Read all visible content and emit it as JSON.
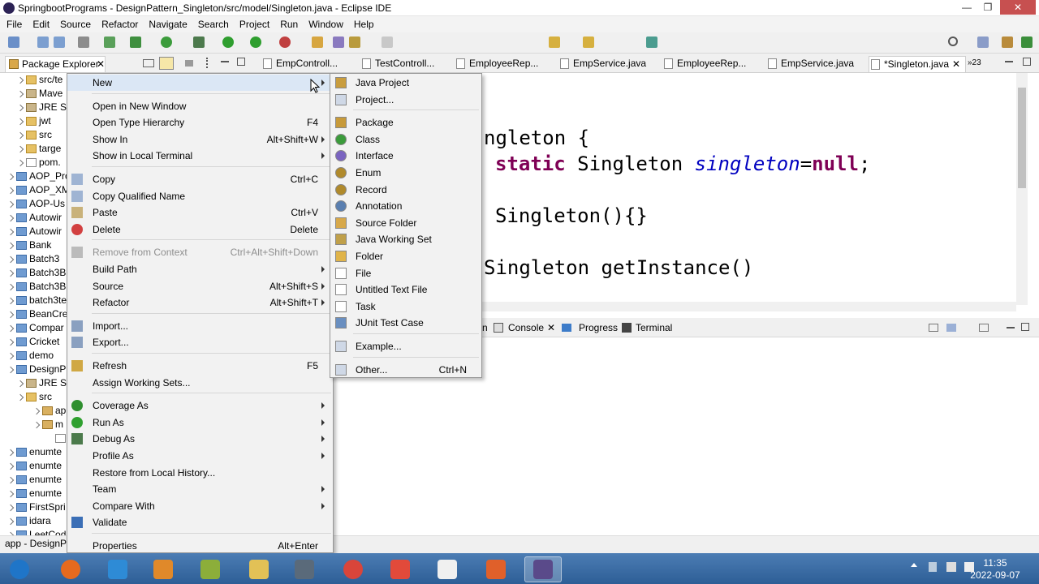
{
  "window": {
    "title": "SpringbootPrograms - DesignPattern_Singleton/src/model/Singleton.java - Eclipse IDE",
    "controls": [
      "—",
      "❐",
      "✕"
    ]
  },
  "menubar": [
    "File",
    "Edit",
    "Source",
    "Refactor",
    "Navigate",
    "Search",
    "Project",
    "Run",
    "Window",
    "Help"
  ],
  "package_explorer": {
    "tab_label": "Package Explorer",
    "tree": [
      {
        "label": "src/te",
        "indent": 2,
        "icon": "folder"
      },
      {
        "label": "Mave",
        "indent": 2,
        "icon": "library"
      },
      {
        "label": "JRE S",
        "indent": 2,
        "icon": "library"
      },
      {
        "label": "jwt",
        "indent": 2,
        "icon": "folder"
      },
      {
        "label": "src",
        "indent": 2,
        "icon": "folder"
      },
      {
        "label": "targe",
        "indent": 2,
        "icon": "folder"
      },
      {
        "label": "pom.",
        "indent": 2,
        "icon": "file"
      },
      {
        "label": "AOP_Pro",
        "indent": 1,
        "icon": "project"
      },
      {
        "label": "AOP_XM",
        "indent": 1,
        "icon": "project"
      },
      {
        "label": "AOP-Us",
        "indent": 1,
        "icon": "project"
      },
      {
        "label": "Autowir",
        "indent": 1,
        "icon": "project"
      },
      {
        "label": "Autowir",
        "indent": 1,
        "icon": "project"
      },
      {
        "label": "Bank",
        "indent": 1,
        "icon": "project"
      },
      {
        "label": "Batch3",
        "indent": 1,
        "icon": "project"
      },
      {
        "label": "Batch3B",
        "indent": 1,
        "icon": "project"
      },
      {
        "label": "Batch3B",
        "indent": 1,
        "icon": "project"
      },
      {
        "label": "batch3te",
        "indent": 1,
        "icon": "project"
      },
      {
        "label": "BeanCre",
        "indent": 1,
        "icon": "project"
      },
      {
        "label": "Compar",
        "indent": 1,
        "icon": "project"
      },
      {
        "label": "Cricket",
        "indent": 1,
        "icon": "project"
      },
      {
        "label": "demo",
        "indent": 1,
        "icon": "project"
      },
      {
        "label": "DesignP",
        "indent": 1,
        "icon": "project"
      },
      {
        "label": "JRE S",
        "indent": 2,
        "icon": "library"
      },
      {
        "label": "src",
        "indent": 2,
        "icon": "folder"
      },
      {
        "label": "ap",
        "indent": 3,
        "icon": "package"
      },
      {
        "label": "m",
        "indent": 3,
        "icon": "package"
      },
      {
        "label": "",
        "indent": 4,
        "icon": "file"
      },
      {
        "label": "enumte",
        "indent": 1,
        "icon": "project"
      },
      {
        "label": "enumte",
        "indent": 1,
        "icon": "project"
      },
      {
        "label": "enumte",
        "indent": 1,
        "icon": "project"
      },
      {
        "label": "enumte",
        "indent": 1,
        "icon": "project"
      },
      {
        "label": "FirstSpri",
        "indent": 1,
        "icon": "project"
      },
      {
        "label": "idara",
        "indent": 1,
        "icon": "project"
      },
      {
        "label": "LeetCod",
        "indent": 1,
        "icon": "project"
      }
    ]
  },
  "editor_tabs": [
    "EmpControll...",
    "TestControll...",
    "EmployeeRep...",
    "EmpService.java",
    "EmployeeRep...",
    "EmpService.java",
    "*Singleton.java"
  ],
  "editor_tab_overflow": "»23",
  "code": {
    "line1": "ngleton {",
    "line2_kw": "static",
    "line2_type": " Singleton ",
    "line2_var": "singleton",
    "line2_eq": "=",
    "line2_null": "null",
    "line2_end": ";",
    "line3": "Singleton(){}",
    "line4": "Singleton getInstance()"
  },
  "console_tabs": {
    "partial": "n",
    "console": "Console",
    "progress": "Progress",
    "terminal": "Terminal"
  },
  "status_text": "app - DesignPat",
  "context_menu": [
    {
      "label": "New",
      "shortcut": "",
      "submenu": true,
      "icon": "",
      "highlight": true
    },
    {
      "sep": true
    },
    {
      "label": "Open in New Window",
      "shortcut": "",
      "submenu": false,
      "icon": ""
    },
    {
      "label": "Open Type Hierarchy",
      "shortcut": "F4",
      "submenu": false,
      "icon": ""
    },
    {
      "label": "Show In",
      "shortcut": "Alt+Shift+W",
      "submenu": true,
      "icon": ""
    },
    {
      "label": "Show in Local Terminal",
      "shortcut": "",
      "submenu": true,
      "icon": ""
    },
    {
      "sep": true
    },
    {
      "label": "Copy",
      "shortcut": "Ctrl+C",
      "submenu": false,
      "icon": "copy"
    },
    {
      "label": "Copy Qualified Name",
      "shortcut": "",
      "submenu": false,
      "icon": "copy"
    },
    {
      "label": "Paste",
      "shortcut": "Ctrl+V",
      "submenu": false,
      "icon": "paste"
    },
    {
      "label": "Delete",
      "shortcut": "Delete",
      "submenu": false,
      "icon": "delete"
    },
    {
      "sep": true
    },
    {
      "label": "Remove from Context",
      "shortcut": "Ctrl+Alt+Shift+Down",
      "submenu": false,
      "icon": "remove",
      "disabled": true
    },
    {
      "label": "Build Path",
      "shortcut": "",
      "submenu": true,
      "icon": ""
    },
    {
      "label": "Source",
      "shortcut": "Alt+Shift+S",
      "submenu": true,
      "icon": ""
    },
    {
      "label": "Refactor",
      "shortcut": "Alt+Shift+T",
      "submenu": true,
      "icon": ""
    },
    {
      "sep": true
    },
    {
      "label": "Import...",
      "shortcut": "",
      "submenu": false,
      "icon": "import"
    },
    {
      "label": "Export...",
      "shortcut": "",
      "submenu": false,
      "icon": "export"
    },
    {
      "sep": true
    },
    {
      "label": "Refresh",
      "shortcut": "F5",
      "submenu": false,
      "icon": "refresh"
    },
    {
      "label": "Assign Working Sets...",
      "shortcut": "",
      "submenu": false,
      "icon": ""
    },
    {
      "sep": true
    },
    {
      "label": "Coverage As",
      "shortcut": "",
      "submenu": true,
      "icon": "coverage"
    },
    {
      "label": "Run As",
      "shortcut": "",
      "submenu": true,
      "icon": "run"
    },
    {
      "label": "Debug As",
      "shortcut": "",
      "submenu": true,
      "icon": "debug"
    },
    {
      "label": "Profile As",
      "shortcut": "",
      "submenu": true,
      "icon": ""
    },
    {
      "label": "Restore from Local History...",
      "shortcut": "",
      "submenu": false,
      "icon": ""
    },
    {
      "label": "Team",
      "shortcut": "",
      "submenu": true,
      "icon": ""
    },
    {
      "label": "Compare With",
      "shortcut": "",
      "submenu": true,
      "icon": ""
    },
    {
      "label": "Validate",
      "shortcut": "",
      "submenu": false,
      "icon": "check"
    },
    {
      "sep": true
    },
    {
      "label": "Properties",
      "shortcut": "Alt+Enter",
      "submenu": false,
      "icon": ""
    }
  ],
  "new_submenu": [
    {
      "label": "Java Project",
      "shortcut": "",
      "icon": "java-project"
    },
    {
      "label": "Project...",
      "shortcut": "",
      "icon": "project"
    },
    {
      "sep": true
    },
    {
      "label": "Package",
      "shortcut": "",
      "icon": "package"
    },
    {
      "label": "Class",
      "shortcut": "",
      "icon": "class"
    },
    {
      "label": "Interface",
      "shortcut": "",
      "icon": "interface"
    },
    {
      "label": "Enum",
      "shortcut": "",
      "icon": "enum"
    },
    {
      "label": "Record",
      "shortcut": "",
      "icon": "record"
    },
    {
      "label": "Annotation",
      "shortcut": "",
      "icon": "annotation"
    },
    {
      "label": "Source Folder",
      "shortcut": "",
      "icon": "source-folder"
    },
    {
      "label": "Java Working Set",
      "shortcut": "",
      "icon": "working-set"
    },
    {
      "label": "Folder",
      "shortcut": "",
      "icon": "folder"
    },
    {
      "label": "File",
      "shortcut": "",
      "icon": "file"
    },
    {
      "label": "Untitled Text File",
      "shortcut": "",
      "icon": "text-file"
    },
    {
      "label": "Task",
      "shortcut": "",
      "icon": "task"
    },
    {
      "label": "JUnit Test Case",
      "shortcut": "",
      "icon": "junit"
    },
    {
      "sep": true
    },
    {
      "label": "Example...",
      "shortcut": "",
      "icon": "example"
    },
    {
      "sep": true
    },
    {
      "label": "Other...",
      "shortcut": "Ctrl+N",
      "icon": "other"
    }
  ],
  "taskbar": {
    "time": "11:35",
    "date": "2022-09-07",
    "apps": [
      "start",
      "firefox",
      "internet-explorer",
      "media-player",
      "notes",
      "file-explorer",
      "calculator",
      "chrome",
      "git",
      "xampp",
      "tools",
      "eclipse"
    ]
  },
  "colors": {
    "keyword": "#7f0055",
    "field": "#0000c0",
    "taskbar": "#3a6ba5",
    "menu_bg": "#f2f2f2",
    "highlight": "#dbe7f5"
  }
}
